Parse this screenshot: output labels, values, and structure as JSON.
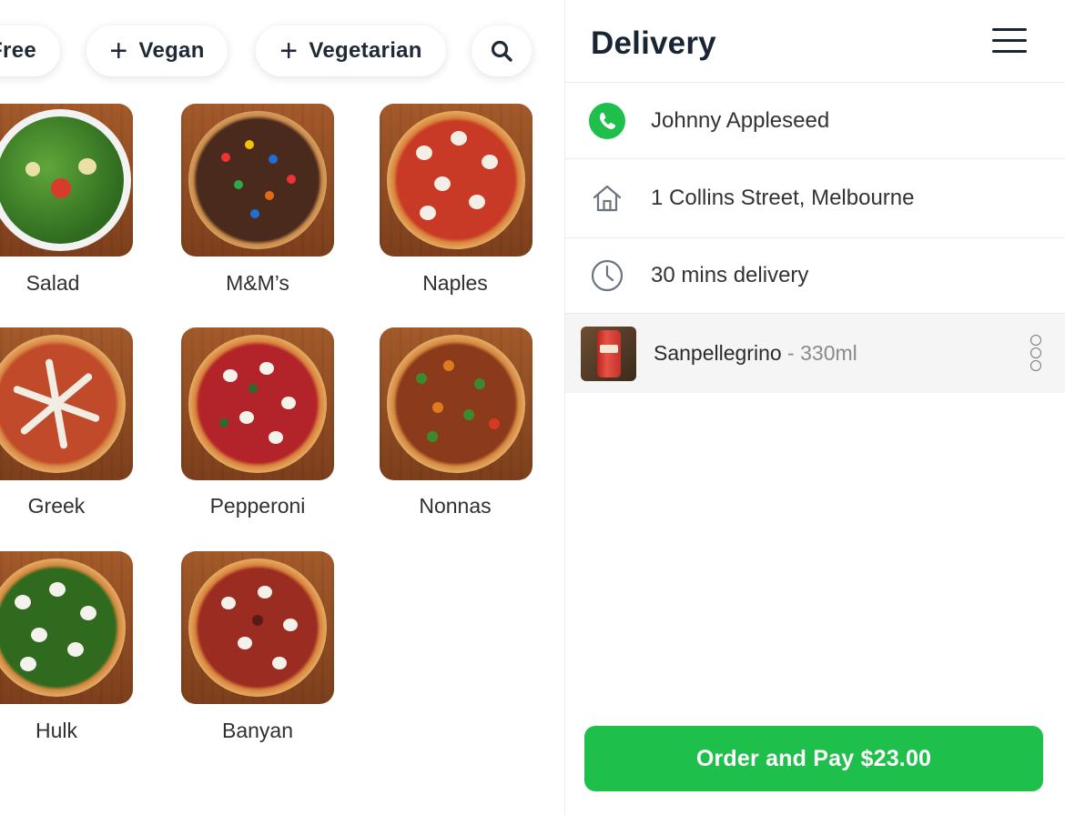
{
  "filters": {
    "free_label": "Free",
    "vegan_label": "Vegan",
    "vegetarian_label": "Vegetarian",
    "plus_glyph": "+"
  },
  "menu": {
    "items": [
      {
        "name": "Salad"
      },
      {
        "name": "M&M’s"
      },
      {
        "name": "Naples"
      },
      {
        "name": "Greek"
      },
      {
        "name": "Pepperoni"
      },
      {
        "name": "Nonnas"
      },
      {
        "name": "Hulk"
      },
      {
        "name": "Banyan"
      }
    ]
  },
  "panel": {
    "title": "Delivery",
    "contact_name": "Johnny Appleseed",
    "address": "1 Collins Street, Melbourne",
    "delivery_time": "30 mins delivery",
    "cart_item": {
      "name": "Sanpellegrino",
      "separator": " - ",
      "size": "330ml"
    },
    "pay_button_label": "Order and Pay $23.00"
  },
  "colors": {
    "accent_green": "#1fbf4c",
    "title_navy": "#1a2533"
  },
  "icons": [
    "search-icon",
    "phone-icon",
    "home-icon",
    "clock-icon",
    "hamburger-icon",
    "more-options-icon"
  ]
}
